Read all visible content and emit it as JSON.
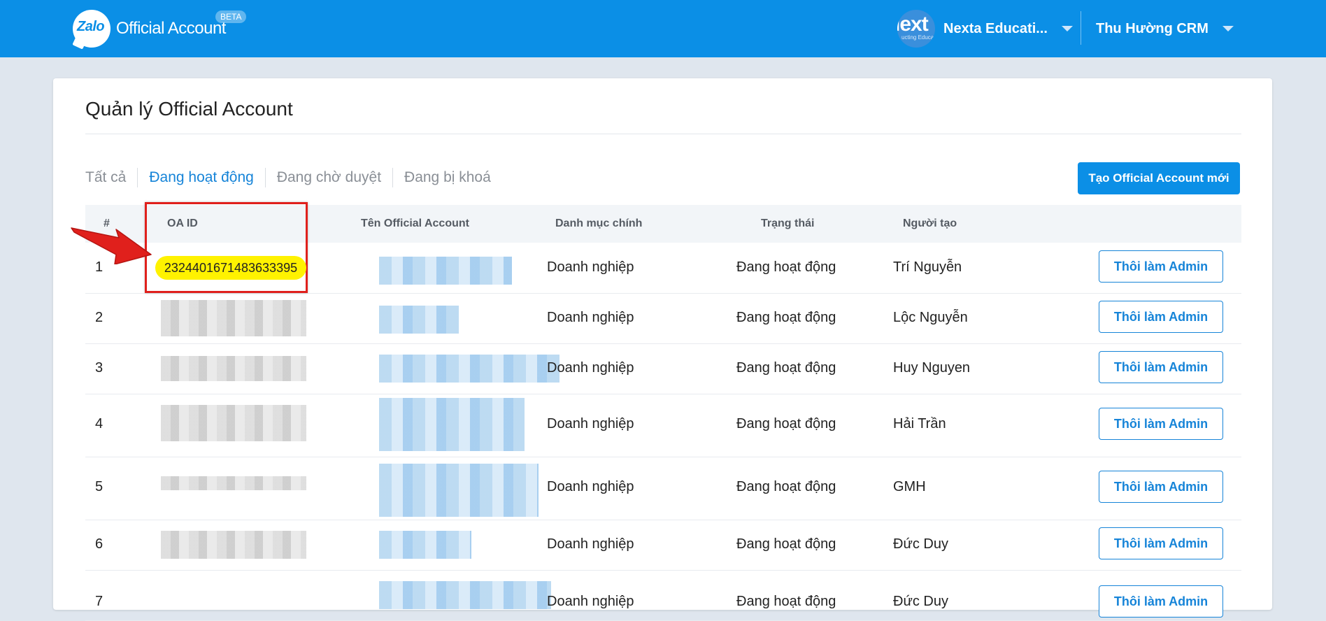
{
  "header": {
    "logo_word": "Zalo",
    "logo_text": "Official Account",
    "beta_label": "BETA",
    "account_avatar_text": "lext",
    "account_avatar_subtext": "ucting Educa",
    "account_name": "Nexta Educati...",
    "user_name": "Thu Hường CRM"
  },
  "page": {
    "title": "Quản lý Official Account",
    "create_button": "Tạo Official Account mới"
  },
  "tabs": [
    {
      "label": "Tất cả",
      "active": false
    },
    {
      "label": "Đang hoạt động",
      "active": true
    },
    {
      "label": "Đang chờ duyệt",
      "active": false
    },
    {
      "label": "Đang bị khoá",
      "active": false
    }
  ],
  "table": {
    "columns": [
      "#",
      "OA ID",
      "Tên Official Account",
      "Danh mục chính",
      "Trạng thái",
      "Người tạo"
    ],
    "rows": [
      {
        "index": "1",
        "oa_id": "2324401671483633395",
        "category": "Doanh nghiệp",
        "status": "Đang hoạt động",
        "creator": "Trí Nguyễn",
        "action": "Thôi làm Admin"
      },
      {
        "index": "2",
        "oa_id": "",
        "category": "Doanh nghiệp",
        "status": "Đang hoạt động",
        "creator": "Lộc Nguyễn",
        "action": "Thôi làm Admin"
      },
      {
        "index": "3",
        "oa_id": "",
        "category": "Doanh nghiệp",
        "status": "Đang hoạt động",
        "creator": "Huy Nguyen",
        "action": "Thôi làm Admin"
      },
      {
        "index": "4",
        "oa_id": "",
        "category": "Doanh nghiệp",
        "status": "Đang hoạt động",
        "creator": "Hải Trần",
        "action": "Thôi làm Admin"
      },
      {
        "index": "5",
        "oa_id": "",
        "category": "Doanh nghiệp",
        "status": "Đang hoạt động",
        "creator": "GMH",
        "action": "Thôi làm Admin"
      },
      {
        "index": "6",
        "oa_id": "",
        "category": "Doanh nghiệp",
        "status": "Đang hoạt động",
        "creator": "Đức Duy",
        "action": "Thôi làm Admin"
      },
      {
        "index": "7",
        "oa_id": "",
        "category": "Doanh nghiệp",
        "status": "Đang hoạt động",
        "creator": "Đức Duy",
        "action": "Thôi làm Admin"
      }
    ]
  },
  "colors": {
    "brand_blue": "#0b8fe6",
    "link_blue": "#1684d8",
    "highlight_yellow": "#fff200",
    "annotation_red": "#e0201c"
  }
}
